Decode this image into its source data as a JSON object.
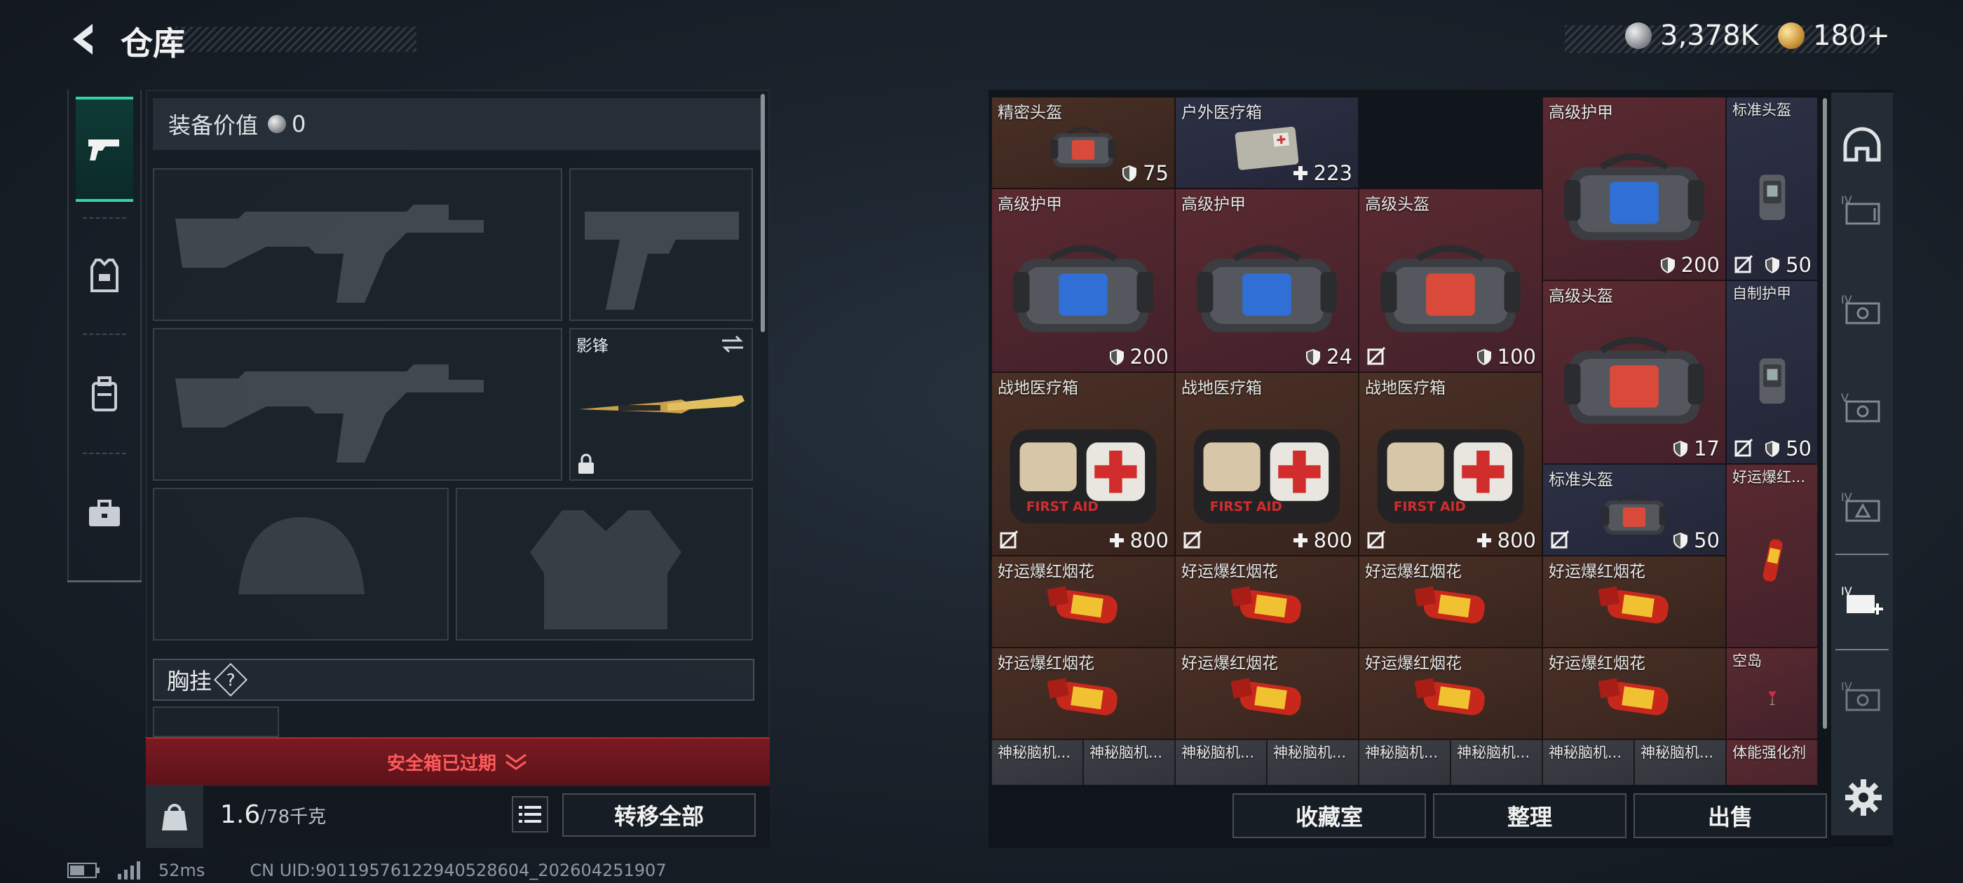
{
  "header": {
    "title": "仓库"
  },
  "currency": [
    {
      "icon": "silver-coin-icon",
      "value": "3,378K"
    },
    {
      "icon": "gold-coin-icon",
      "value": "180+"
    }
  ],
  "equipment": {
    "value_label": "装备价值",
    "value": "0"
  },
  "loadout": {
    "secondary_weapon_name": "影锋",
    "chest_label": "胸挂",
    "chest_help": "?"
  },
  "safebox": {
    "expired_label": "安全箱已过期"
  },
  "weight": {
    "current": "1.6",
    "max": "/78千克"
  },
  "buttons": {
    "transfer_all": "转移全部",
    "collection": "收藏室",
    "organize": "整理",
    "sell": "出售"
  },
  "status": {
    "ping": "52ms",
    "uid": "CN UID:9011957612294052860­4_202604251907"
  },
  "storage": [
    {
      "name": "精密头盔",
      "value": "75",
      "vicon": "shield",
      "nodurab": false,
      "kind": "helmet",
      "bg": "brown"
    },
    {
      "name": "户外医疗箱",
      "value": "223",
      "vicon": "plus",
      "nodurab": false,
      "kind": "medpack",
      "bg": "navy"
    },
    {
      "name": "高级护甲",
      "value": "200",
      "vicon": "shield",
      "nodurab": false,
      "kind": "armor",
      "bg": "red"
    },
    {
      "name": "标准头盔",
      "value": "50",
      "vicon": "shield",
      "nodurab": true,
      "kind": "backpack",
      "bg": "navy"
    },
    {
      "name": "高级护甲",
      "value": "200",
      "vicon": "shield",
      "nodurab": false,
      "kind": "armor",
      "bg": "red"
    },
    {
      "name": "高级护甲",
      "value": "24",
      "vicon": "shield",
      "nodurab": false,
      "kind": "armor",
      "bg": "red"
    },
    {
      "name": "高级头盔",
      "value": "100",
      "vicon": "shield",
      "nodurab": true,
      "kind": "helmet",
      "bg": "red"
    },
    {
      "name": "高级头盔",
      "value": "17",
      "vicon": "shield",
      "nodurab": false,
      "kind": "helmet",
      "bg": "red"
    },
    {
      "name": "自制护甲",
      "value": "50",
      "vicon": "shield",
      "nodurab": true,
      "kind": "backpack",
      "bg": "navy"
    },
    {
      "name": "战地医疗箱",
      "value": "800",
      "vicon": "plus",
      "nodurab": true,
      "kind": "firstaid",
      "bg": "brown"
    },
    {
      "name": "战地医疗箱",
      "value": "800",
      "vicon": "plus",
      "nodurab": true,
      "kind": "firstaid",
      "bg": "brown"
    },
    {
      "name": "战地医疗箱",
      "value": "800",
      "vicon": "plus",
      "nodurab": true,
      "kind": "firstaid",
      "bg": "brown"
    },
    {
      "name": "标准头盔",
      "value": "50",
      "vicon": "shield",
      "nodurab": true,
      "kind": "helmet",
      "bg": "navy"
    },
    {
      "name": "好运爆红...",
      "value": "",
      "vicon": "",
      "nodurab": false,
      "kind": "firecracker-tall",
      "bg": "red"
    },
    {
      "name": "好运爆红烟花",
      "value": "",
      "vicon": "",
      "nodurab": false,
      "kind": "firecracker",
      "bg": "brown"
    },
    {
      "name": "好运爆红烟花",
      "value": "",
      "vicon": "",
      "nodurab": false,
      "kind": "firecracker",
      "bg": "brown"
    },
    {
      "name": "好运爆红烟花",
      "value": "",
      "vicon": "",
      "nodurab": false,
      "kind": "firecracker",
      "bg": "brown"
    },
    {
      "name": "好运爆红烟花",
      "value": "",
      "vicon": "",
      "nodurab": false,
      "kind": "firecracker",
      "bg": "brown"
    },
    {
      "name": "好运爆红烟花",
      "value": "",
      "vicon": "",
      "nodurab": false,
      "kind": "firecracker",
      "bg": "brown"
    },
    {
      "name": "好运爆红烟花",
      "value": "",
      "vicon": "",
      "nodurab": false,
      "kind": "firecracker",
      "bg": "brown"
    },
    {
      "name": "好运爆红烟花",
      "value": "",
      "vicon": "",
      "nodurab": false,
      "kind": "firecracker",
      "bg": "brown"
    },
    {
      "name": "好运爆红烟花",
      "value": "",
      "vicon": "",
      "nodurab": false,
      "kind": "firecracker",
      "bg": "brown"
    },
    {
      "name": "空岛",
      "value": "",
      "vicon": "",
      "nodurab": false,
      "kind": "cocktail",
      "bg": "red"
    },
    {
      "name": "神秘脑机...",
      "value": "",
      "vicon": "",
      "nodurab": false,
      "kind": "chip",
      "bg": "gray"
    },
    {
      "name": "神秘脑机...",
      "value": "",
      "vicon": "",
      "nodurab": false,
      "kind": "chip",
      "bg": "gray"
    },
    {
      "name": "神秘脑机...",
      "value": "",
      "vicon": "",
      "nodurab": false,
      "kind": "chip",
      "bg": "gray"
    },
    {
      "name": "神秘脑机...",
      "value": "",
      "vicon": "",
      "nodurab": false,
      "kind": "chip",
      "bg": "gray"
    },
    {
      "name": "神秘脑机...",
      "value": "",
      "vicon": "",
      "nodurab": false,
      "kind": "chip",
      "bg": "gray"
    },
    {
      "name": "神秘脑机...",
      "value": "",
      "vicon": "",
      "nodurab": false,
      "kind": "chip",
      "bg": "gray"
    },
    {
      "name": "神秘脑机...",
      "value": "",
      "vicon": "",
      "nodurab": false,
      "kind": "chip",
      "bg": "gray"
    },
    {
      "name": "神秘脑机...",
      "value": "",
      "vicon": "",
      "nodurab": false,
      "kind": "chip",
      "bg": "gray"
    },
    {
      "name": "体能强化剂",
      "value": "",
      "vicon": "",
      "nodurab": false,
      "kind": "syringe",
      "bg": "red"
    }
  ],
  "sidebar_right": [
    "helmet-category-icon",
    "storage-iv-1-icon",
    "storage-iv-2-icon",
    "storage-v-icon",
    "storage-iv-3-icon",
    "storage-iv-add-icon",
    "storage-iv-4-icon"
  ],
  "colors": {
    "accent": "#2fd6a4",
    "danger": "#ff5a5a",
    "safebar": "#6d1820"
  }
}
